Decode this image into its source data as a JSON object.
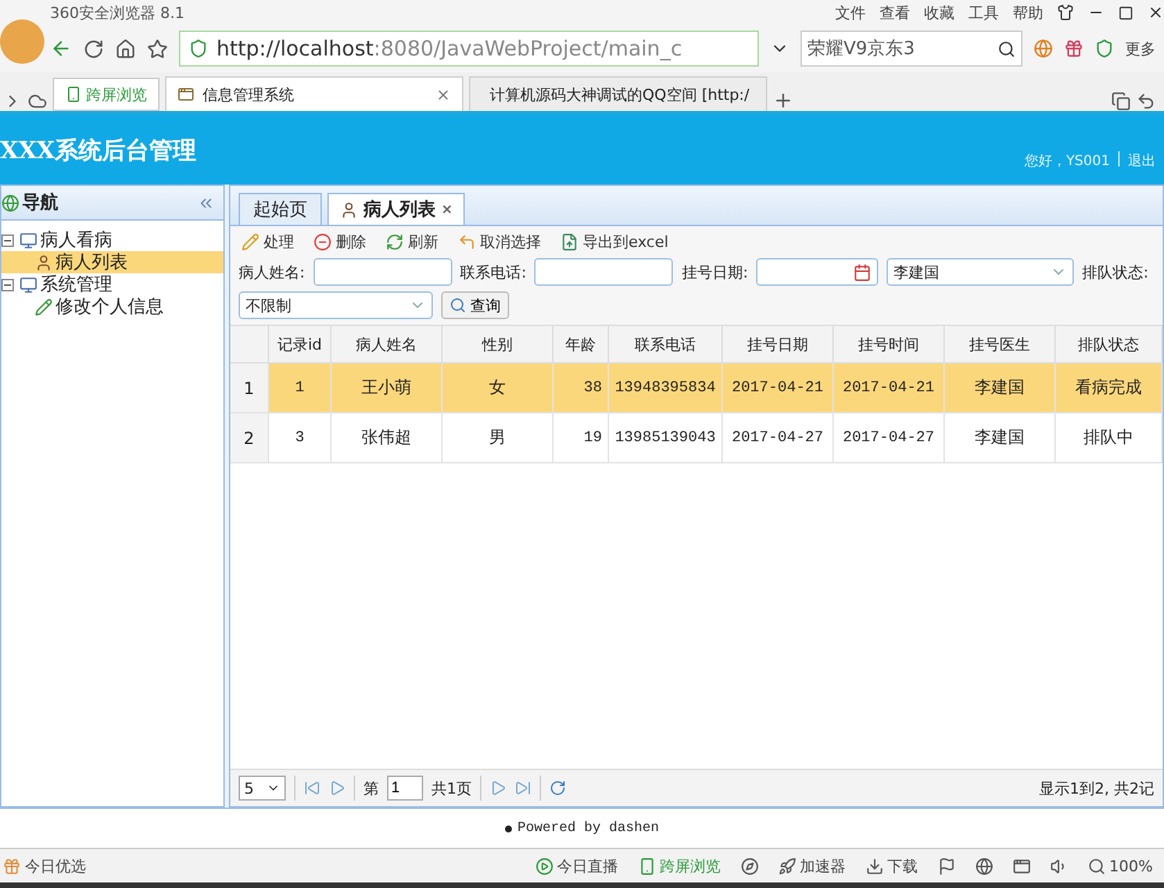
{
  "browser": {
    "title": "360安全浏览器 8.1",
    "menu": [
      "文件",
      "查看",
      "收藏",
      "工具",
      "帮助"
    ],
    "url_host": "http://localhost",
    "url_rest": ":8080/JavaWebProject/main_c",
    "search": "荣耀V9京东3",
    "more": "更多",
    "cross_screen": "跨屏浏览",
    "tabs": [
      {
        "label": "信息管理系统",
        "selected": true
      },
      {
        "label": "计算机源码大神调试的QQ空间 [http:/",
        "selected": false
      }
    ]
  },
  "header": {
    "title": "XXX系统后台管理",
    "greeting": "您好，YS001",
    "logout": "退出"
  },
  "nav": {
    "title": "导航",
    "tree": [
      {
        "label": "病人看病",
        "expanded": true,
        "children": [
          {
            "label": "病人列表",
            "selected": true
          }
        ]
      },
      {
        "label": "系统管理",
        "expanded": true,
        "children": [
          {
            "label": "修改个人信息",
            "selected": false
          }
        ]
      }
    ]
  },
  "main_tabs": [
    {
      "label": "起始页",
      "selected": false
    },
    {
      "label": "病人列表",
      "selected": true,
      "close": "×"
    }
  ],
  "toolbar": [
    "处理",
    "删除",
    "刷新",
    "取消选择",
    "导出到excel"
  ],
  "filters": [
    {
      "kind": "text",
      "label": "病人姓名:"
    },
    {
      "kind": "text",
      "label": "联系电话:"
    },
    {
      "kind": "date",
      "label": "挂号日期:"
    },
    {
      "kind": "select",
      "value": "李建国"
    },
    {
      "kind": "label",
      "label": "排队状态:"
    },
    {
      "kind": "select",
      "value": "不限制"
    },
    {
      "kind": "button",
      "label": "查询"
    }
  ],
  "table": {
    "columns": [
      "记录id",
      "病人姓名",
      "性别",
      "年龄",
      "联系电话",
      "挂号日期",
      "挂号时间",
      "挂号医生",
      "排队状态"
    ],
    "rows": [
      {
        "number": "1",
        "selected": true,
        "cells": [
          "1",
          "王小萌",
          "女",
          "38",
          "13948395834",
          "2017-04-21",
          "2017-04-21",
          "李建国",
          "看病完成"
        ]
      },
      {
        "number": "2",
        "selected": false,
        "cells": [
          "3",
          "张伟超",
          "男",
          "19",
          "13985139043",
          "2017-04-27",
          "2017-04-27",
          "李建国",
          "排队中"
        ]
      }
    ]
  },
  "pager": {
    "page_size": "5",
    "page_prefix": "第",
    "page": "1",
    "page_total": "共1页",
    "summary": "显示1到2, 共2记"
  },
  "footer": "Powered by dashen",
  "status_bar": {
    "left": "今日优选",
    "items": [
      "今日直播",
      "跨屏浏览",
      "加速器",
      "下载",
      "100%"
    ]
  }
}
